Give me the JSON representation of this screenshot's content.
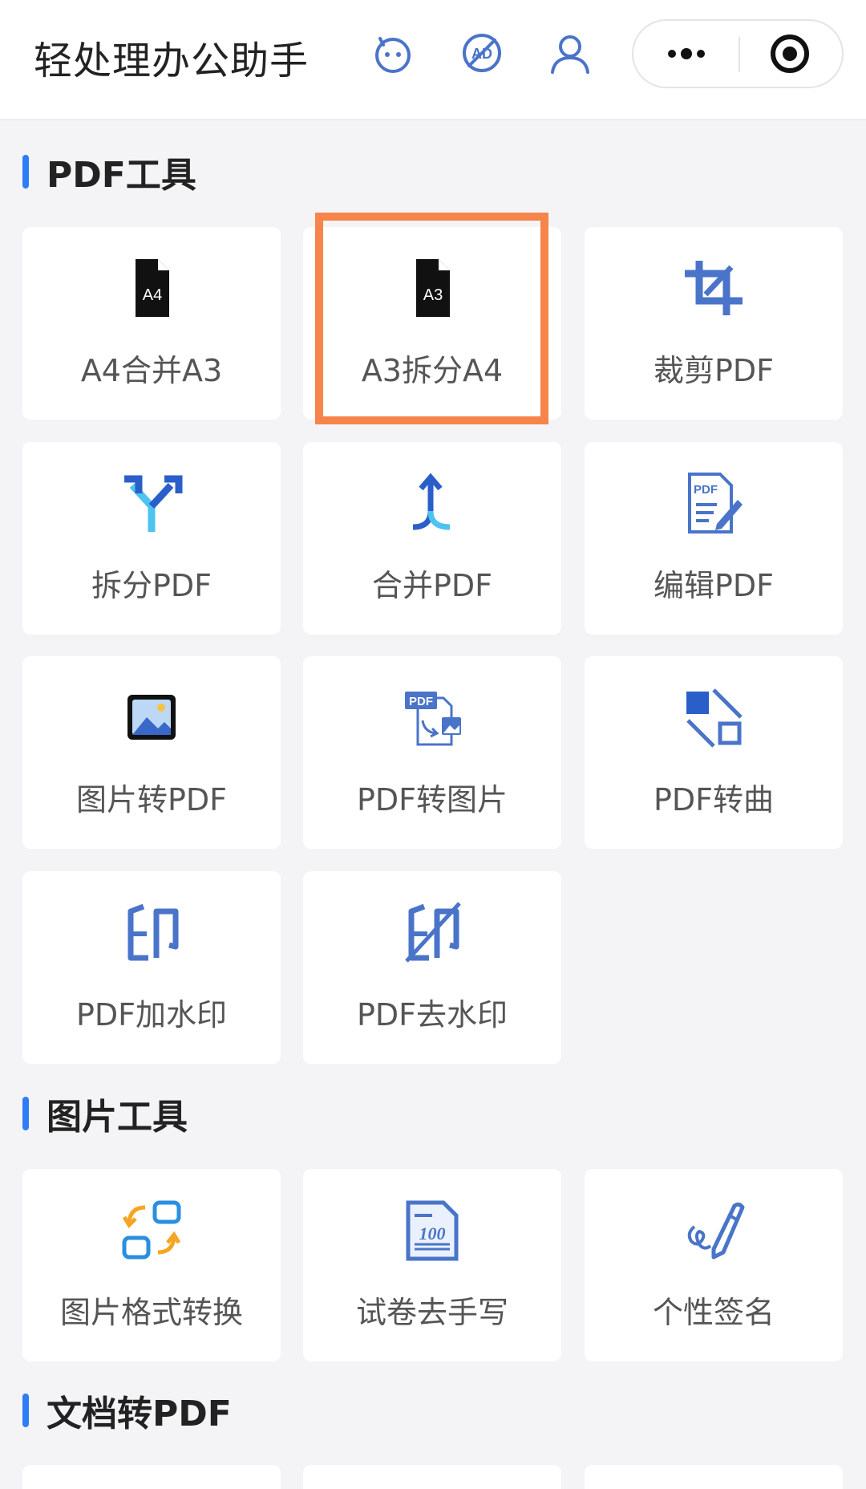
{
  "header": {
    "title": "轻处理办公助手",
    "icons": [
      "bot-icon",
      "no-ads-icon",
      "user-icon"
    ],
    "capsule": {
      "more_icon": "more-dots-icon",
      "close_icon": "target-circle-icon"
    }
  },
  "sections": [
    {
      "title": "PDF工具",
      "items": [
        {
          "label": "A4合并A3",
          "icon": "doc-a4-icon",
          "icon_text": "A4"
        },
        {
          "label": "A3拆分A4",
          "icon": "doc-a3-icon",
          "icon_text": "A3",
          "highlighted": true
        },
        {
          "label": "裁剪PDF",
          "icon": "crop-icon"
        },
        {
          "label": "拆分PDF",
          "icon": "split-arrows-icon"
        },
        {
          "label": "合并PDF",
          "icon": "merge-arrows-icon"
        },
        {
          "label": "编辑PDF",
          "icon": "pdf-edit-icon",
          "icon_text": "PDF"
        },
        {
          "label": "图片转PDF",
          "icon": "image-icon"
        },
        {
          "label": "PDF转图片",
          "icon": "pdf-to-image-icon",
          "icon_text": "PDF"
        },
        {
          "label": "PDF转曲",
          "icon": "shape-convert-icon"
        },
        {
          "label": "PDF加水印",
          "icon": "watermark-add-icon"
        },
        {
          "label": "PDF去水印",
          "icon": "watermark-remove-icon"
        }
      ]
    },
    {
      "title": "图片工具",
      "items": [
        {
          "label": "图片格式转换",
          "icon": "format-convert-icon"
        },
        {
          "label": "试卷去手写",
          "icon": "exam-paper-icon",
          "icon_text": "100"
        },
        {
          "label": "个性签名",
          "icon": "signature-pen-icon"
        }
      ]
    },
    {
      "title": "文档转PDF",
      "items": []
    }
  ],
  "colors": {
    "accent": "#2f7df6",
    "icon_blue": "#4a74c9",
    "highlight": "#f7844a",
    "orange": "#f5a524",
    "background": "#f4f4f6"
  }
}
